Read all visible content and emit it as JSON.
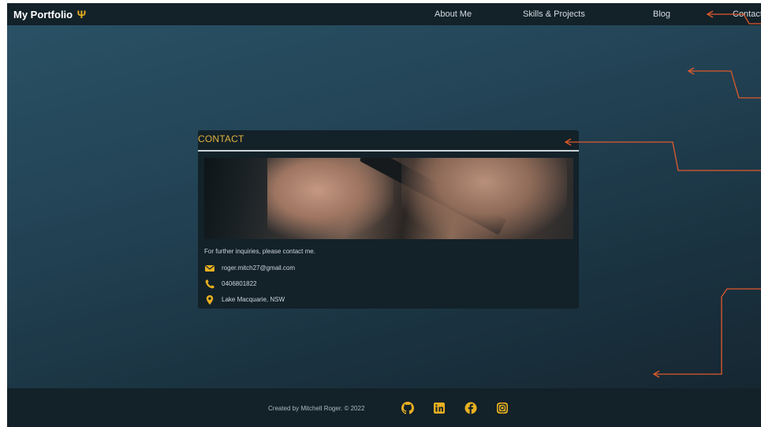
{
  "nav": {
    "brand": "My Portfolio",
    "brand_icon": "trident-icon",
    "links": [
      "About Me",
      "Skills & Projects",
      "Blog",
      "Contact"
    ]
  },
  "contact": {
    "title": "CONTACT",
    "photo": "hands-holding-phone-image",
    "intro": "For further inquiries, please contact me.",
    "email": "roger.mitch27@gmail.com",
    "phone": "0406801822",
    "location": "Lake Macquarie, NSW"
  },
  "footer": {
    "credit": "Created by Mitchell Roger. © 2022",
    "social": [
      "github-icon",
      "linkedin-icon",
      "facebook-icon",
      "instagram-icon"
    ]
  },
  "colors": {
    "accent": "#e8b020",
    "annotation": "#e05a2b",
    "nav_bg": "#132129"
  }
}
